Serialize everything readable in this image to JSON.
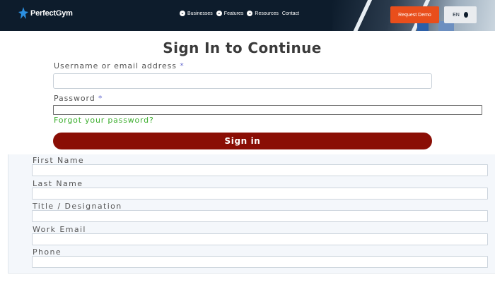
{
  "nav": {
    "brand": "PerfectGym",
    "links": [
      {
        "label": "Businesses"
      },
      {
        "label": "Features"
      },
      {
        "label": "Resources"
      },
      {
        "label": "Contact"
      }
    ],
    "request_demo": "Request Demo",
    "language": "EN"
  },
  "signin": {
    "title": "Sign In to Continue",
    "username_label": "Username or email address",
    "password_label": "Password",
    "required_marker": "*",
    "forgot_link": "Forgot your password?",
    "submit": "Sign in"
  },
  "registration": {
    "first_name_label": "First Name",
    "last_name_label": "Last Name",
    "title_label": "Title / Designation",
    "work_email_label": "Work Email",
    "phone_label": "Phone"
  },
  "colors": {
    "nav_bg": "#0d1c2c",
    "accent_orange": "#e94e1b",
    "signin_button": "#8a0e05",
    "forgot_link": "#3cae2e",
    "required_marker": "#6a6fd0"
  }
}
